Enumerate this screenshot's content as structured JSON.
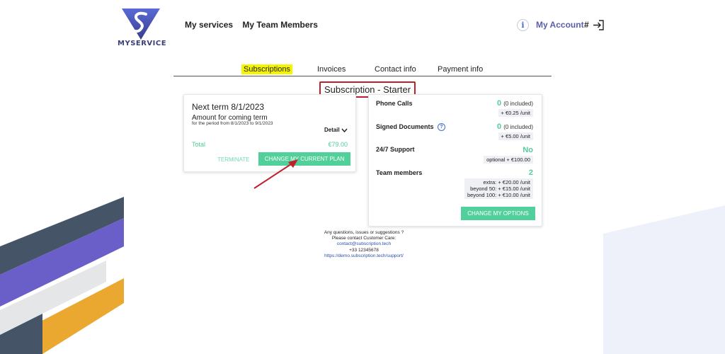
{
  "header": {
    "logo_text": "MYSERVICE",
    "nav": [
      "My services",
      "My Team Members"
    ],
    "info_icon": "i",
    "my_account": "My Account",
    "hash": "#"
  },
  "tabs": [
    {
      "label": "Subscriptions",
      "active": true
    },
    {
      "label": "Invoices",
      "active": false
    },
    {
      "label": "Contact info",
      "active": false
    },
    {
      "label": "Payment info",
      "active": false
    }
  ],
  "subscription_title": "Subscription - Starter",
  "term_card": {
    "next_term": "Next term 8/1/2023",
    "amount_label": "Amount for coming term",
    "period": "for the period from 8/1/2023 to 9/1/2023",
    "detail": "Detail",
    "total_label": "Total",
    "total_value": "€79.00",
    "terminate": "TERMINATE",
    "change_plan": "CHANGE MY CURRENT PLAN"
  },
  "options_card": {
    "phone_calls": {
      "label": "Phone Calls",
      "value": "0",
      "included": "(0 included)",
      "extra": "+ €0.25 /unit"
    },
    "signed_documents": {
      "label": "Signed Documents",
      "value": "0",
      "included": "(0 included)",
      "extra": "+ €5.00 /unit"
    },
    "support": {
      "label": "24/7 Support",
      "value": "No",
      "extra": "optional + €100.00"
    },
    "team_members": {
      "label": "Team members",
      "value": "2",
      "extra1": "extra: + €20.00 /unit",
      "extra2": "beyond 50: + €15.00 /unit",
      "extra3": "beyond 100: + €10.00 /unit"
    },
    "change_options": "CHANGE MY OPTIONS"
  },
  "footer": {
    "line1": "Any questions, issues or suggestions ?",
    "line2": "Please contact Customer Care:",
    "email": "contact@subscription.tech",
    "phone": "+33 12345678",
    "url": "https://demo.subscription.tech/support/"
  },
  "colors": {
    "accent_green": "#52d09b",
    "nav_account": "#5a5fa8",
    "highlight_yellow": "#f5f500",
    "callout_red": "#c0202a"
  }
}
